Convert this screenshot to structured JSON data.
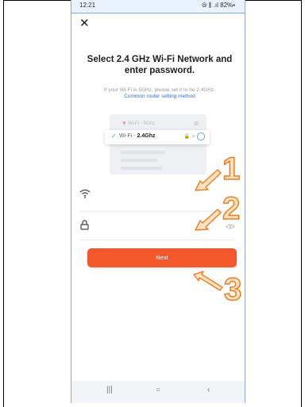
{
  "status_bar": {
    "time": "12:21",
    "right": "⦾ ⫼ .ıl 82%▪"
  },
  "header": {
    "close_glyph": "✕"
  },
  "main": {
    "title": "Select 2.4 GHz Wi-Fi Network and enter password.",
    "subtitle": "If your Wi-Fi is 5GHz, please set it to be 2.4GHz.",
    "link": "Common router setting method",
    "illustration": {
      "row_5ghz": "Wi-Fi - 5Ghz",
      "row_24_prefix": "Wi-Fi - ",
      "row_24_bold": "2.4Ghz"
    },
    "wifi_field": {
      "icon": "wifi-icon",
      "value": ""
    },
    "password_field": {
      "icon": "lock-icon",
      "value": "",
      "toggle_icon": "eye-icon"
    },
    "next_label": "Next"
  },
  "annotations": {
    "one": "1",
    "two": "2",
    "three": "3",
    "color": "#ef7d22"
  },
  "nav_bar": {
    "recent": "|||",
    "home": "○",
    "back": "‹"
  }
}
